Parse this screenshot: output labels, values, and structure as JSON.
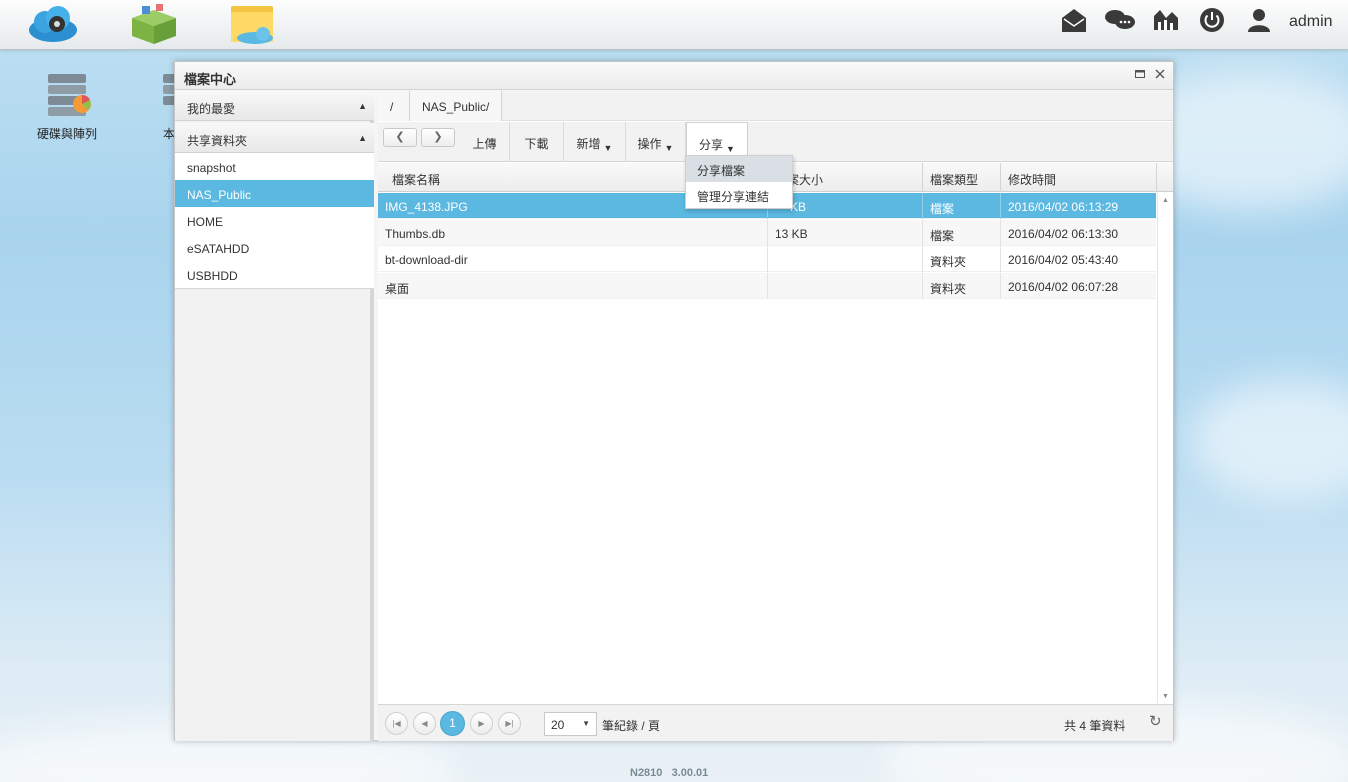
{
  "topbar": {
    "apps": [
      {
        "name": "cloud-app-icon"
      },
      {
        "name": "app-center-icon"
      },
      {
        "name": "file-center-icon"
      }
    ],
    "right_icons": [
      "mail-icon",
      "chat-icon",
      "monitor-icon",
      "power-icon",
      "user-icon"
    ],
    "user": "admin"
  },
  "desktop": {
    "icons": [
      {
        "label": "硬碟與陣列"
      },
      {
        "label": "本"
      }
    ]
  },
  "window": {
    "title": "檔案中心",
    "left": {
      "favorites": "我的最愛",
      "shared": "共享資料夾",
      "folders": [
        "snapshot",
        "NAS_Public",
        "HOME",
        "eSATAHDD",
        "USBHDD"
      ],
      "selected_folder": "NAS_Public"
    },
    "breadcrumb": [
      "/",
      "NAS_Public/"
    ],
    "toolbar": {
      "upload": "上傳",
      "download": "下載",
      "new": "新增",
      "actions": "操作",
      "share": "分享"
    },
    "share_menu": [
      "分享檔案",
      "管理分享連結"
    ],
    "columns": [
      "檔案名稱",
      "檔案大小",
      "檔案類型",
      "修改時間"
    ],
    "rows": [
      {
        "name": "IMG_4138.JPG",
        "size": "KB",
        "type": "檔案",
        "modified": "2016/04/02 06:13:29",
        "selected": true
      },
      {
        "name": "Thumbs.db",
        "size": "13 KB",
        "type": "檔案",
        "modified": "2016/04/02 06:13:30"
      },
      {
        "name": "bt-download-dir",
        "size": "",
        "type": "資料夾",
        "modified": "2016/04/02 05:43:40"
      },
      {
        "name": "桌面",
        "size": "",
        "type": "資料夾",
        "modified": "2016/04/02 06:07:28"
      }
    ],
    "footer": {
      "current_page": "1",
      "page_size": "20",
      "per_page_label": "筆紀錄 / 頁",
      "total": "共 4 筆資料"
    }
  },
  "version": "N2810   3.00.01",
  "colors": {
    "accent": "#5bb8e0"
  }
}
